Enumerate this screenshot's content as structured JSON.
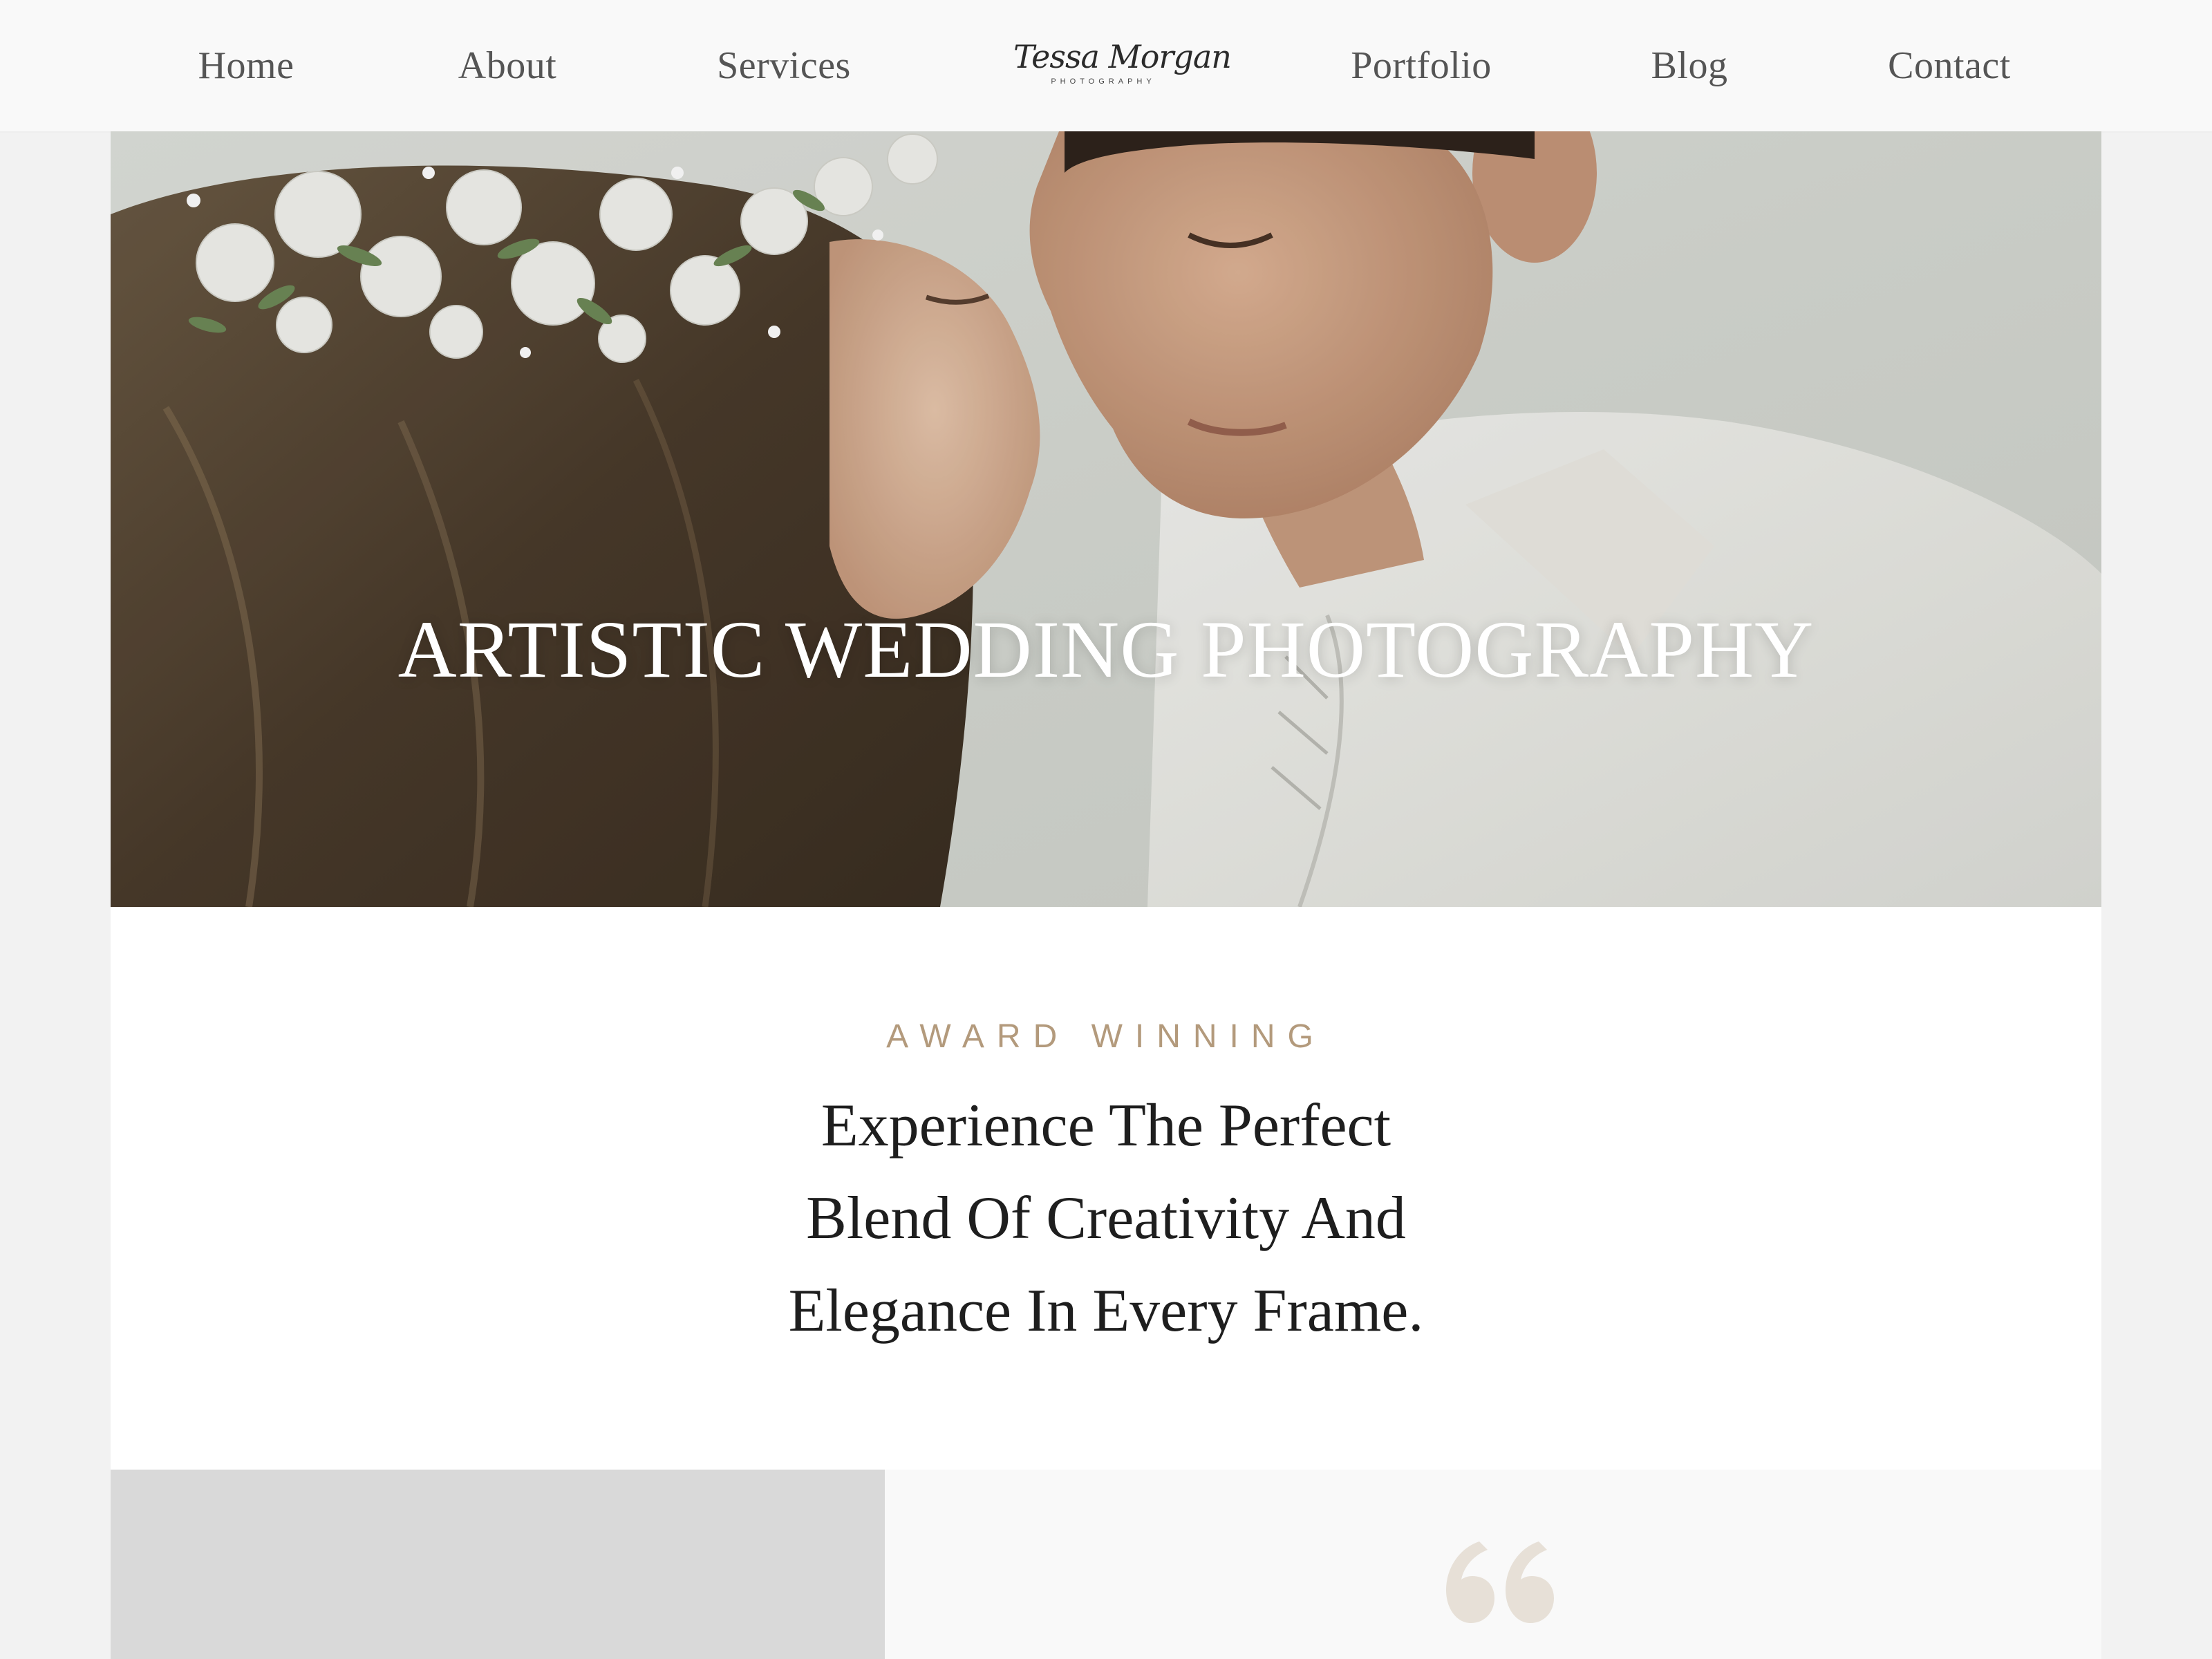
{
  "nav": {
    "left_items": [
      {
        "label": "Home"
      },
      {
        "label": "About"
      },
      {
        "label": "Services"
      }
    ],
    "logo": {
      "name": "Tessa Morgan",
      "tagline": "PHOTOGRAPHY"
    },
    "right_items": [
      {
        "label": "Portfolio"
      },
      {
        "label": "Blog"
      },
      {
        "label": "Contact"
      }
    ]
  },
  "hero": {
    "title": "ARTISTIC WEDDING PHOTOGRAPHY"
  },
  "intro": {
    "eyebrow": "AWARD WINNING",
    "heading": "Experience The Perfect Blend Of Creativity And Elegance In Every Frame."
  },
  "testimonial": {
    "quote_icon": "quote-icon"
  },
  "colors": {
    "accent": "#b39a7c",
    "quote_mark": "#e7e0d7",
    "text_dark": "#1e1e1e",
    "nav_text": "#555555"
  }
}
